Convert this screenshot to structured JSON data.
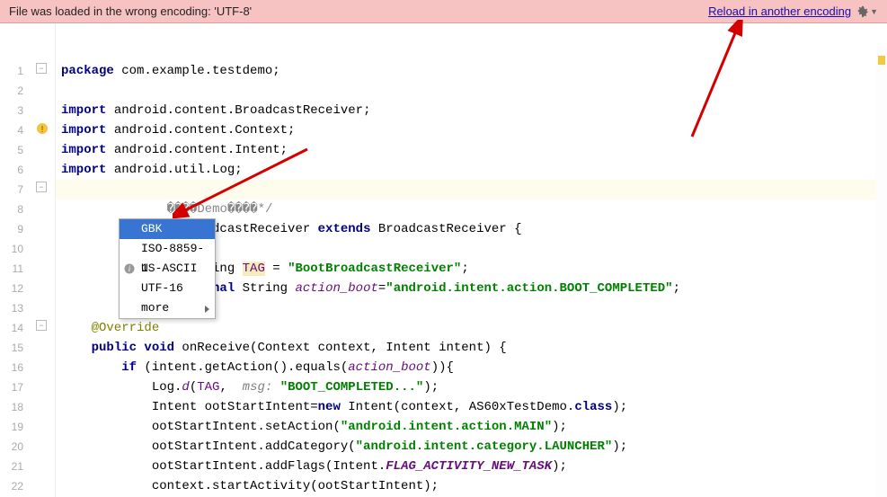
{
  "banner": {
    "message": "File was loaded in the wrong encoding: 'UTF-8'",
    "link": "Reload in another encoding"
  },
  "line_numbers": [
    "1",
    "2",
    "3",
    "4",
    "5",
    "6",
    "7",
    "8",
    "9",
    "10",
    "11",
    "12",
    "13",
    "14",
    "15",
    "16",
    "17",
    "18",
    "19",
    "20",
    "21",
    "22"
  ],
  "encoding_menu": {
    "items": [
      {
        "label": "GBK",
        "selected": true
      },
      {
        "label": "ISO-8859-1",
        "selected": false
      },
      {
        "label": "US-ASCII",
        "selected": false,
        "icon": "info"
      },
      {
        "label": "UTF-16",
        "selected": false
      },
      {
        "label": "more",
        "selected": false,
        "submenu": true
      }
    ]
  },
  "code": {
    "l1": {
      "kw": "package",
      "rest": " com.example.testdemo;"
    },
    "l3": {
      "kw": "import",
      "rest": " android.content.BroadcastReceiver;"
    },
    "l4": {
      "kw": "import",
      "rest": " android.content.Context;"
    },
    "l5": {
      "kw": "import",
      "rest": " android.content.Intent;"
    },
    "l6": {
      "kw": "import",
      "rest": " android.util.Log;"
    },
    "l8": "              ����Demo����*/",
    "l9": {
      "pre": "              otBroadcastReceiver ",
      "kw": "extends",
      "post": " BroadcastReceiver {"
    },
    "l11": {
      "pre": "              al String ",
      "tag": "TAG",
      "mid": " = ",
      "str": "\"BootBroadcastReceiver\"",
      "end": ";"
    },
    "l12": {
      "pre": "              ",
      "kw": "tic final",
      "mid": " String ",
      "var": "action_boot",
      "eq": "=",
      "str": "\"android.intent.action.BOOT_COMPLETED\"",
      "end": ";"
    },
    "l14": "    @Override",
    "l15": {
      "ind": "    ",
      "kw": "public void",
      "mid": " onReceive(Context context, Intent intent) {"
    },
    "l16": {
      "ind": "        ",
      "kw": "if",
      "mid": " (intent.getAction().equals(",
      "var": "action_boot",
      "end": ")){"
    },
    "l17": {
      "ind": "            Log.",
      "m": "d",
      "open": "(",
      "tag": "TAG",
      "comma": ",  ",
      "p": "msg: ",
      "str": "\"BOOT_COMPLETED...\"",
      "end": ");"
    },
    "l18": {
      "ind": "            Intent ootStartIntent=",
      "kw": "new",
      "mid": " Intent(context, AS60xTestDemo.",
      "kw2": "class",
      "end": ");"
    },
    "l19": {
      "ind": "            ootStartIntent.setAction(",
      "str": "\"android.intent.action.MAIN\"",
      "end": ");"
    },
    "l20": {
      "ind": "            ootStartIntent.addCategory(",
      "str": "\"android.intent.category.LAUNCHER\"",
      "end": ");"
    },
    "l21": {
      "ind": "            ootStartIntent.addFlags(Intent.",
      "c": "FLAG_ACTIVITY_NEW_TASK",
      "end": ");"
    },
    "l22": "            context.startActivity(ootStartIntent);"
  }
}
